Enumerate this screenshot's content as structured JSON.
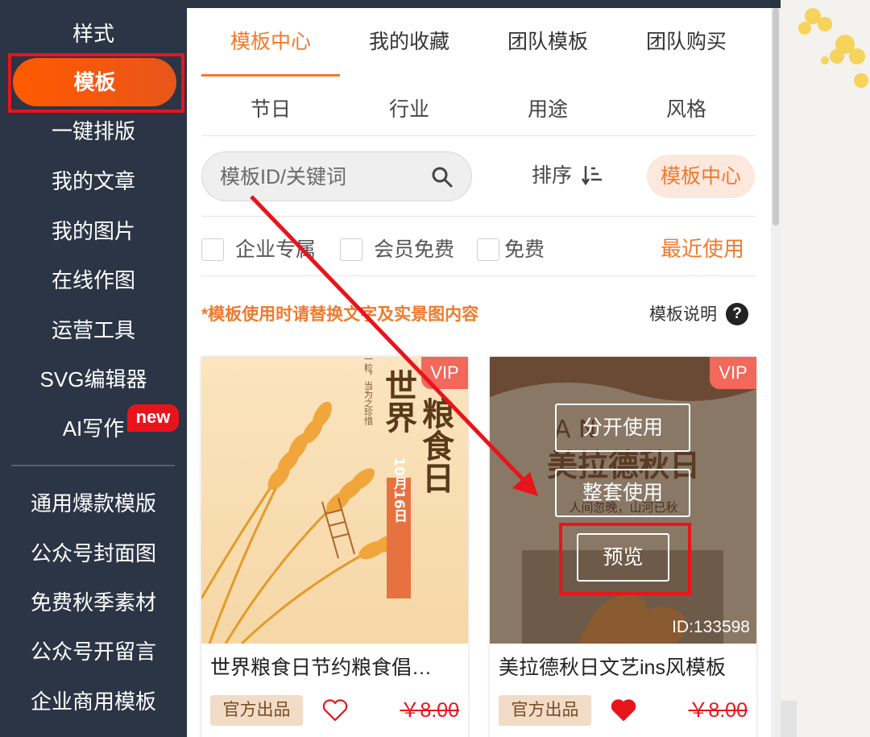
{
  "sidebar": {
    "items": [
      {
        "label": "样式"
      },
      {
        "label": "模板"
      },
      {
        "label": "一键排版"
      },
      {
        "label": "我的文章"
      },
      {
        "label": "我的图片"
      },
      {
        "label": "在线作图"
      },
      {
        "label": "运营工具"
      },
      {
        "label": "SVG编辑器"
      },
      {
        "label": "AI写作"
      }
    ],
    "new_badge": "new",
    "lower_items": [
      {
        "label": "通用爆款模版"
      },
      {
        "label": "公众号封面图"
      },
      {
        "label": "免费秋季素材"
      },
      {
        "label": "公众号开留言"
      },
      {
        "label": "企业商用模板"
      }
    ]
  },
  "tabs": [
    {
      "label": "模板中心"
    },
    {
      "label": "我的收藏"
    },
    {
      "label": "团队模板"
    },
    {
      "label": "团队购买"
    }
  ],
  "subtabs": [
    {
      "label": "节日"
    },
    {
      "label": "行业"
    },
    {
      "label": "用途"
    },
    {
      "label": "风格"
    }
  ],
  "search": {
    "placeholder": "模板ID/关键词"
  },
  "sort": {
    "label": "排序"
  },
  "center_button": "模板中心",
  "filters": [
    {
      "label": "企业专属"
    },
    {
      "label": "会员免费"
    },
    {
      "label": "免费"
    }
  ],
  "recent_label": "最近使用",
  "notice": "*模板使用时请替换文字及实景图内容",
  "explain": "模板说明",
  "help": "?",
  "cards": [
    {
      "vip": "VIP",
      "title": "世界粮食日节约粮食倡…",
      "poster": {
        "headline_1": "世界",
        "headline_2": "粮食日",
        "date": "10月16日",
        "slogan": "一粟一粒，当为之珍惜"
      },
      "official": "官方出品",
      "price": "￥8.00"
    },
    {
      "vip": "VIP",
      "title": "美拉德秋日文艺ins风模板",
      "poster": {
        "headline": "美拉德秋日",
        "sub": "人间忽晚，山河已秋",
        "letters": "A     N"
      },
      "id": "ID:133598",
      "overlay": [
        "分开使用",
        "整套使用",
        "预览"
      ],
      "official": "官方出品",
      "price": "￥8.00"
    }
  ],
  "colors": {
    "accent": "#f07a2c",
    "highlight": "#e8141c",
    "sidebar_bg": "#2b3545"
  }
}
